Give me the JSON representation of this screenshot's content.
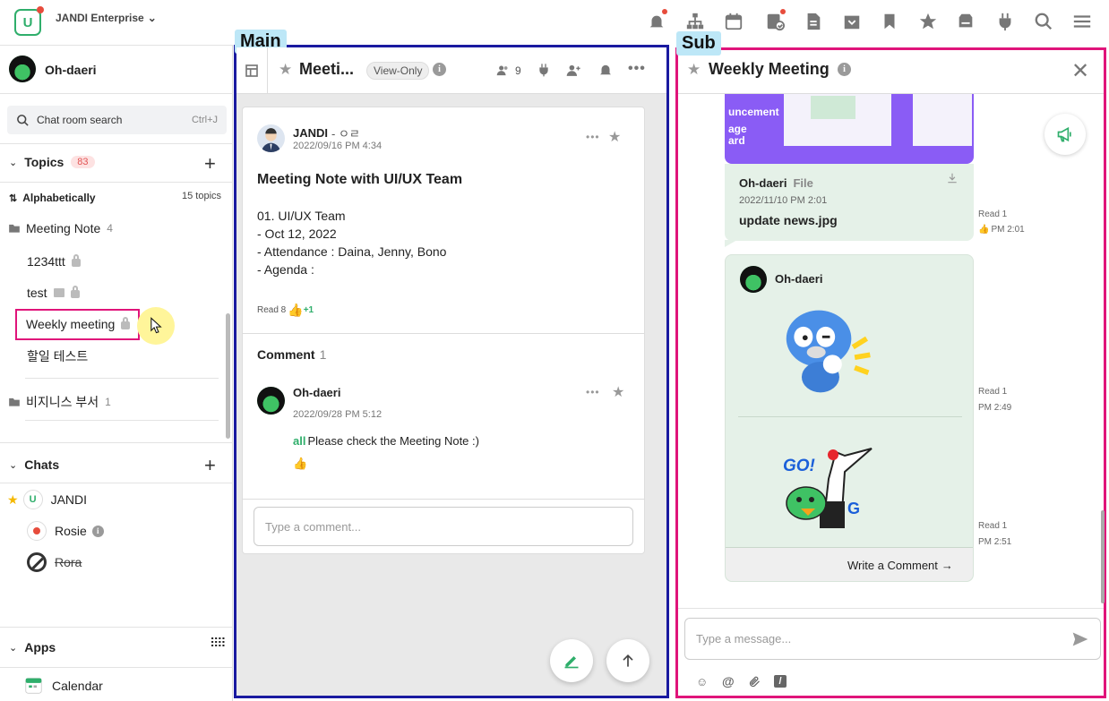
{
  "app": {
    "name": "JANDI Enterprise",
    "logo_letter": "U"
  },
  "labels": {
    "main": "Main",
    "sub": "Sub"
  },
  "user": {
    "name": "Oh-daeri"
  },
  "search": {
    "placeholder": "Chat room search",
    "shortcut": "Ctrl+J"
  },
  "topics": {
    "title": "Topics",
    "count": "83",
    "sort": "Alphabetically",
    "total": "15 topics",
    "folder": {
      "name": "Meeting Note",
      "count": "4"
    },
    "items": [
      {
        "label": "1234ttt"
      },
      {
        "label": "test"
      },
      {
        "label": "Weekly meeting"
      },
      {
        "label": "할일 테스트"
      }
    ],
    "folder2": {
      "name": "비지니스 부서",
      "count": "1"
    }
  },
  "chats": {
    "title": "Chats",
    "items": [
      {
        "label": "JANDI"
      },
      {
        "label": "Rosie"
      },
      {
        "label": "Rora"
      }
    ]
  },
  "apps": {
    "title": "Apps",
    "items": [
      {
        "label": "Calendar"
      }
    ]
  },
  "main": {
    "title": "Meeti...",
    "view_only": "View-Only",
    "members": "9",
    "post": {
      "author": "JANDI",
      "author_suffix": "- ㅇㄹ",
      "date": "2022/09/16 PM 4:34",
      "title": "Meeting Note with UI/UX Team",
      "lines": [
        "01. UI/UX Team",
        "- Oct 12, 2022",
        "- Attendance : Daina, Jenny, Bono",
        "- Agenda :"
      ],
      "read": "Read 8",
      "likes": "+1"
    },
    "comment": {
      "title": "Comment",
      "count": "1",
      "author": "Oh-daeri",
      "date": "2022/09/28 PM 5:12",
      "mention": "all",
      "text": "Please check the Meeting Note :)",
      "placeholder": "Type a comment..."
    }
  },
  "sub": {
    "title": "Weekly Meeting",
    "file": {
      "author": "Oh-daeri",
      "tag": "File",
      "date": "2022/11/10 PM 2:01",
      "name": "update news.jpg",
      "read": "Read 1",
      "time": "PM 2:01",
      "preview_lines": [
        "uncement",
        "age",
        "ard"
      ]
    },
    "sticker": {
      "author": "Oh-daeri",
      "read1": "Read 1",
      "time1": "PM 2:49",
      "read2": "Read 1",
      "time2": "PM 2:51",
      "go_text": "GO!",
      "g_text": "G",
      "write": "Write a Comment"
    },
    "placeholder": "Type a message..."
  }
}
